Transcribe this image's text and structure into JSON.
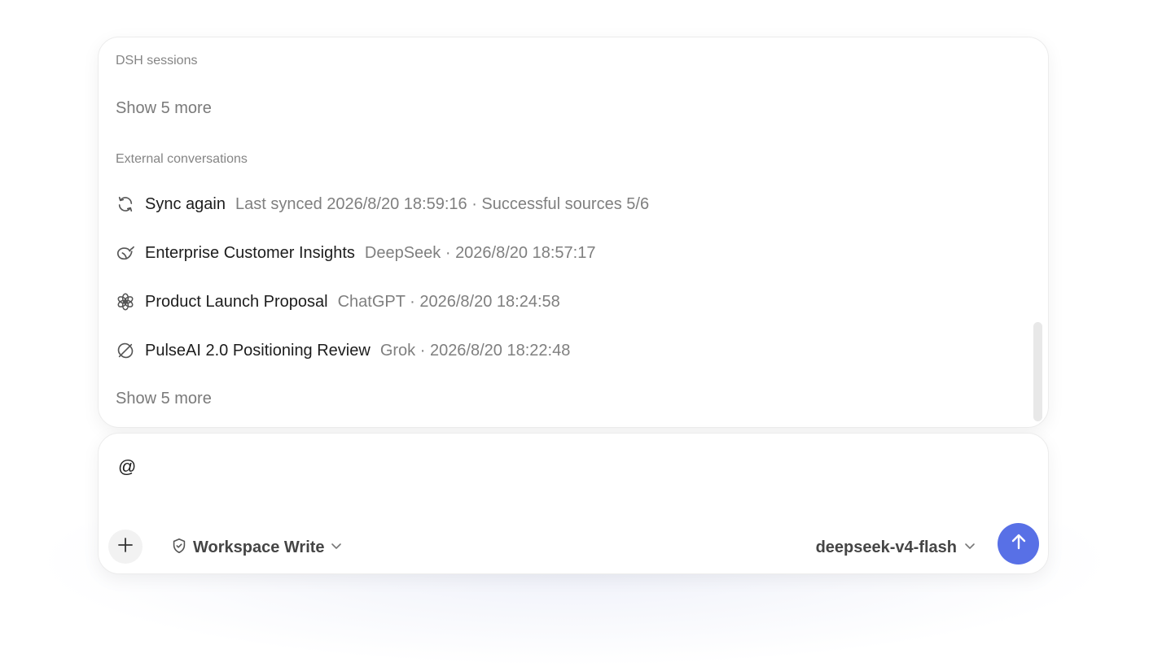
{
  "colors": {
    "accent": "#5870e6",
    "muted_text": "#7f7f7f",
    "label_text": "#858585"
  },
  "picker": {
    "dsh_section_label": "DSH sessions",
    "dsh_show_more": "Show 5 more",
    "external_section_label": "External conversations",
    "sync_row": {
      "icon": "refresh-icon",
      "title": "Sync again",
      "meta": "Last synced 2026/8/20 18:59:16 · Successful sources 5/6"
    },
    "conversations": [
      {
        "icon": "deepseek-whale-icon",
        "title": "Enterprise Customer Insights",
        "meta": "DeepSeek · 2026/8/20 18:57:17"
      },
      {
        "icon": "chatgpt-icon",
        "title": "Product Launch Proposal",
        "meta": "ChatGPT · 2026/8/20 18:24:58"
      },
      {
        "icon": "grok-icon",
        "title": "PulseAI 2.0 Positioning Review",
        "meta": "Grok · 2026/8/20 18:22:48"
      }
    ],
    "external_show_more": "Show 5 more"
  },
  "composer": {
    "input_value": "@",
    "mode_label": "Workspace Write",
    "model_label": "deepseek-v4-flash"
  }
}
